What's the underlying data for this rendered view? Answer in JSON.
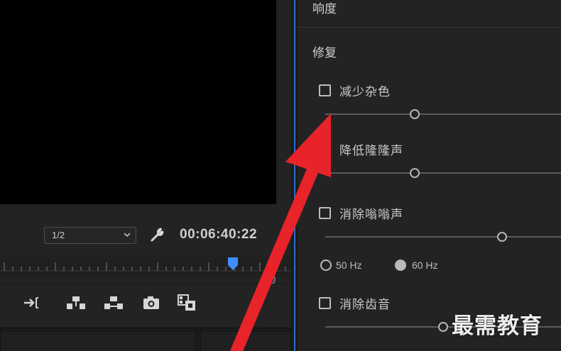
{
  "monitor": {
    "zoom_level": "1/2",
    "timecode": "00:06:40:22"
  },
  "toolbar": {
    "icons": [
      "go-to-out-icon",
      "lift-icon",
      "extract-icon",
      "export-frame-icon",
      "comparison-view-icon"
    ]
  },
  "sound_panel": {
    "loudness_label": "响度",
    "repair_label": "修复",
    "options": [
      {
        "label": "减少杂色",
        "checked": false,
        "slider_value": 0.38
      },
      {
        "label": "降低隆隆声",
        "checked": false,
        "slider_value": 0.38
      },
      {
        "label": "消除嗡嗡声",
        "checked": false,
        "slider_value": 0.75
      },
      {
        "label": "消除齿音",
        "checked": false,
        "slider_value": 0.5
      }
    ],
    "hum_frequency": {
      "options": [
        "50 Hz",
        "60 Hz"
      ],
      "selected": "60 Hz"
    }
  },
  "watermark": "最需教育",
  "colors": {
    "accent_blue": "#2e6bd1",
    "annotation_red": "#e8232a",
    "playhead_blue": "#3f8dff"
  }
}
